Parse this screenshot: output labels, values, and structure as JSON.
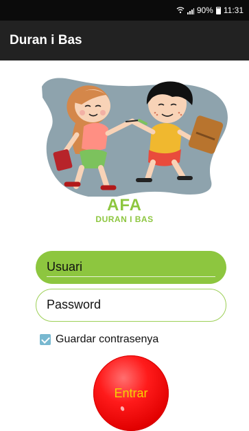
{
  "status_bar": {
    "battery_percent": "90%",
    "time": "11:31",
    "icons": {
      "wifi": "wifi-icon",
      "signal": "signal-icon",
      "battery": "battery-icon"
    }
  },
  "app_bar": {
    "title": "Duran i Bas"
  },
  "brand": {
    "title": "AFA",
    "subtitle": "DURAN I BAS",
    "color": "#8dc63f"
  },
  "form": {
    "user_placeholder": "Usuari",
    "password_placeholder": "Password",
    "remember_label": "Guardar contrasenya",
    "remember_checked": true,
    "checkbox_color": "#78b8d0",
    "submit_label": "Entrar",
    "submit_color": "#e10000"
  },
  "colors": {
    "status_bar": "#0b0b0b",
    "app_bar": "#222222",
    "accent_green": "#8dc63f"
  }
}
